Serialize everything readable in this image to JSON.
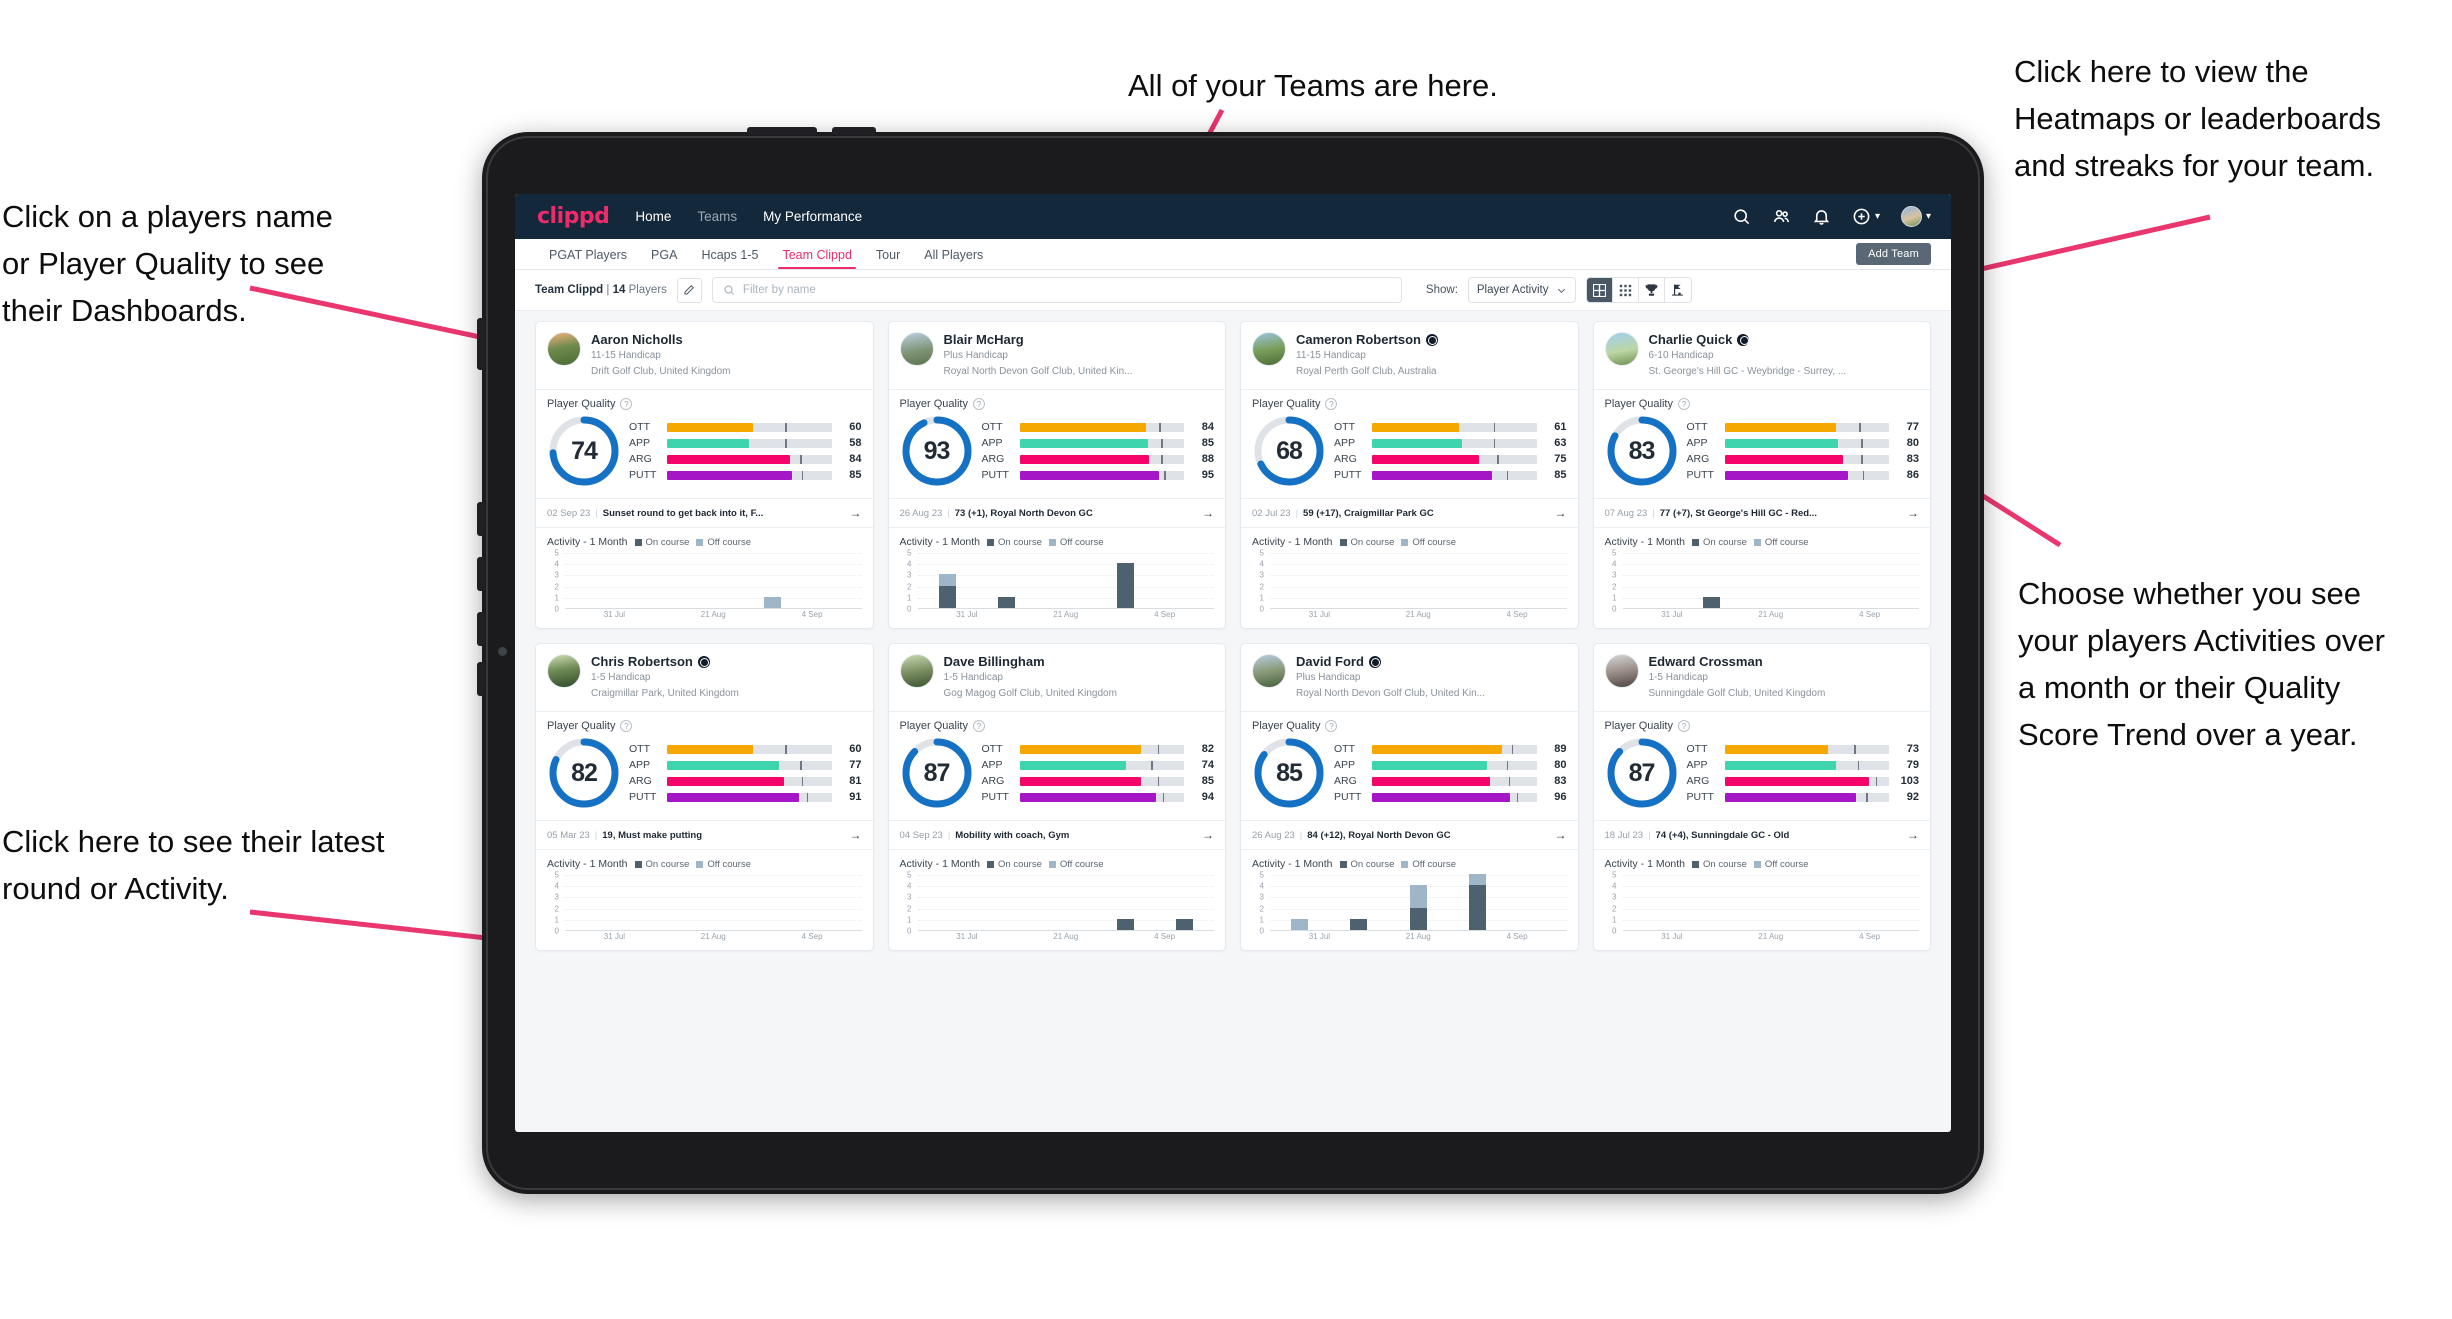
{
  "annotations": [
    {
      "id": "a-teams",
      "text": "All of your Teams are here."
    },
    {
      "id": "a-heatmap",
      "text": "Click here to view the\nHeatmaps or leaderboards\nand streaks for your team."
    },
    {
      "id": "a-name",
      "text": "Click on a players name\nor Player Quality to see\ntheir Dashboards."
    },
    {
      "id": "a-choose",
      "text": "Choose whether you see\nyour players Activities over\na month or their Quality\nScore Trend over a year."
    },
    {
      "id": "a-latest",
      "text": "Click here to see their latest\nround or Activity."
    }
  ],
  "app": {
    "brand": "clippd",
    "nav_links": [
      {
        "label": "Home",
        "active": true
      },
      {
        "label": "Teams",
        "active": false
      },
      {
        "label": "My Performance",
        "active": true
      }
    ],
    "nav_icons": [
      "search-icon",
      "people-icon",
      "bell-icon",
      "plus-circle-icon",
      "avatar"
    ],
    "tabs": [
      {
        "label": "PGAT Players",
        "active": false
      },
      {
        "label": "PGA",
        "active": false
      },
      {
        "label": "Hcaps 1-5",
        "active": false
      },
      {
        "label": "Team Clippd",
        "active": true
      },
      {
        "label": "Tour",
        "active": false
      },
      {
        "label": "All Players",
        "active": false
      }
    ],
    "add_team_label": "Add Team",
    "toolbar": {
      "team_name": "Team Clippd",
      "divider": "|",
      "player_count": "14",
      "players_word": "Players",
      "edit_icon": "pencil-icon",
      "search_placeholder": "Filter by name",
      "search_value": "",
      "show_label": "Show:",
      "show_value": "Player Activity",
      "show_options": [
        "Player Activity",
        "Quality Score Trend"
      ],
      "views": [
        {
          "name": "grid-large-view",
          "active": true
        },
        {
          "name": "grid-small-view",
          "active": false
        },
        {
          "name": "trophy-leaderboard-view",
          "active": false
        },
        {
          "name": "flag-course-view",
          "active": false
        }
      ]
    }
  },
  "card_labels": {
    "player_quality": "Player Quality",
    "activity": "Activity - 1 Month",
    "legend_on": "On course",
    "legend_off": "Off course",
    "metric_keys": [
      "OTT",
      "APP",
      "ARG",
      "PUTT"
    ]
  },
  "metric_colors": {
    "OTT": "#f5a800",
    "APP": "#3ed4ae",
    "ARG": "#f5056a",
    "PUTT": "#a516c6",
    "ring": "#1471c4",
    "track": "#dfe3e7"
  },
  "chart_data": {
    "type": "bar",
    "stacked": true,
    "ylim": [
      0,
      5
    ],
    "yticks": [
      0,
      1,
      2,
      3,
      4,
      5
    ],
    "xticks": [
      "31 Jul",
      "21 Aug",
      "4 Sep"
    ],
    "series_names": [
      "On course",
      "Off course"
    ],
    "series_colors": [
      "#4d616f",
      "#9fb6c8"
    ]
  },
  "players": [
    {
      "avatar_class": "av1",
      "name": "Aaron Nicholls",
      "verified": false,
      "handicap": "11-15 Handicap",
      "club": "Drift Golf Club, United Kingdom",
      "quality": 74,
      "metrics": [
        {
          "key": "OTT",
          "value": 60,
          "fill": 52,
          "tick": 72
        },
        {
          "key": "APP",
          "value": 58,
          "fill": 50,
          "tick": 72
        },
        {
          "key": "ARG",
          "value": 84,
          "fill": 75,
          "tick": 81
        },
        {
          "key": "PUTT",
          "value": 85,
          "fill": 76,
          "tick": 82
        }
      ],
      "latest_date": "02 Sep 23",
      "latest_text": "Sunset round to get back into it, F...",
      "activity": [
        {
          "on": 0,
          "off": 0
        },
        {
          "on": 0,
          "off": 0
        },
        {
          "on": 0,
          "off": 0
        },
        {
          "on": 0,
          "off": 1
        },
        {
          "on": 0,
          "off": 0
        }
      ]
    },
    {
      "avatar_class": "av2",
      "name": "Blair McHarg",
      "verified": false,
      "handicap": "Plus Handicap",
      "club": "Royal North Devon Golf Club, United Kin...",
      "quality": 93,
      "metrics": [
        {
          "key": "OTT",
          "value": 84,
          "fill": 77,
          "tick": 85
        },
        {
          "key": "APP",
          "value": 85,
          "fill": 78,
          "tick": 86
        },
        {
          "key": "ARG",
          "value": 88,
          "fill": 79,
          "tick": 86
        },
        {
          "key": "PUTT",
          "value": 95,
          "fill": 85,
          "tick": 88
        }
      ],
      "latest_date": "26 Aug 23",
      "latest_text": "73 (+1), Royal North Devon GC",
      "activity": [
        {
          "on": 2,
          "off": 1
        },
        {
          "on": 1,
          "off": 0
        },
        {
          "on": 0,
          "off": 0
        },
        {
          "on": 4,
          "off": 0
        },
        {
          "on": 0,
          "off": 0
        }
      ]
    },
    {
      "avatar_class": "av3",
      "name": "Cameron Robertson",
      "verified": true,
      "handicap": "11-15 Handicap",
      "club": "Royal Perth Golf Club, Australia",
      "quality": 68,
      "metrics": [
        {
          "key": "OTT",
          "value": 61,
          "fill": 53,
          "tick": 74
        },
        {
          "key": "APP",
          "value": 63,
          "fill": 55,
          "tick": 74
        },
        {
          "key": "ARG",
          "value": 75,
          "fill": 65,
          "tick": 76
        },
        {
          "key": "PUTT",
          "value": 85,
          "fill": 73,
          "tick": 82
        }
      ],
      "latest_date": "02 Jul 23",
      "latest_text": "59 (+17), Craigmillar Park GC",
      "activity": [
        {
          "on": 0,
          "off": 0
        },
        {
          "on": 0,
          "off": 0
        },
        {
          "on": 0,
          "off": 0
        },
        {
          "on": 0,
          "off": 0
        },
        {
          "on": 0,
          "off": 0
        }
      ]
    },
    {
      "avatar_class": "av4",
      "name": "Charlie Quick",
      "verified": true,
      "handicap": "6-10 Handicap",
      "club": "St. George's Hill GC - Weybridge - Surrey, ...",
      "quality": 83,
      "metrics": [
        {
          "key": "OTT",
          "value": 77,
          "fill": 68,
          "tick": 82
        },
        {
          "key": "APP",
          "value": 80,
          "fill": 69,
          "tick": 83
        },
        {
          "key": "ARG",
          "value": 83,
          "fill": 72,
          "tick": 83
        },
        {
          "key": "PUTT",
          "value": 86,
          "fill": 75,
          "tick": 84
        }
      ],
      "latest_date": "07 Aug 23",
      "latest_text": "77 (+7), St George's Hill GC - Red...",
      "activity": [
        {
          "on": 0,
          "off": 0
        },
        {
          "on": 1,
          "off": 0
        },
        {
          "on": 0,
          "off": 0
        },
        {
          "on": 0,
          "off": 0
        },
        {
          "on": 0,
          "off": 0
        }
      ]
    },
    {
      "avatar_class": "av5",
      "name": "Chris Robertson",
      "verified": true,
      "handicap": "1-5 Handicap",
      "club": "Craigmillar Park, United Kingdom",
      "quality": 82,
      "metrics": [
        {
          "key": "OTT",
          "value": 60,
          "fill": 52,
          "tick": 72
        },
        {
          "key": "APP",
          "value": 77,
          "fill": 68,
          "tick": 81
        },
        {
          "key": "ARG",
          "value": 81,
          "fill": 71,
          "tick": 82
        },
        {
          "key": "PUTT",
          "value": 91,
          "fill": 80,
          "tick": 85
        }
      ],
      "latest_date": "05 Mar 23",
      "latest_text": "19, Must make putting",
      "activity": [
        {
          "on": 0,
          "off": 0
        },
        {
          "on": 0,
          "off": 0
        },
        {
          "on": 0,
          "off": 0
        },
        {
          "on": 0,
          "off": 0
        },
        {
          "on": 0,
          "off": 0
        }
      ]
    },
    {
      "avatar_class": "av6",
      "name": "Dave Billingham",
      "verified": false,
      "handicap": "1-5 Handicap",
      "club": "Gog Magog Golf Club, United Kingdom",
      "quality": 87,
      "metrics": [
        {
          "key": "OTT",
          "value": 82,
          "fill": 74,
          "tick": 84
        },
        {
          "key": "APP",
          "value": 74,
          "fill": 65,
          "tick": 80
        },
        {
          "key": "ARG",
          "value": 85,
          "fill": 74,
          "tick": 84
        },
        {
          "key": "PUTT",
          "value": 94,
          "fill": 83,
          "tick": 87
        }
      ],
      "latest_date": "04 Sep 23",
      "latest_text": "Mobility with coach, Gym",
      "activity": [
        {
          "on": 0,
          "off": 0
        },
        {
          "on": 0,
          "off": 0
        },
        {
          "on": 0,
          "off": 0
        },
        {
          "on": 1,
          "off": 0
        },
        {
          "on": 1,
          "off": 0
        }
      ]
    },
    {
      "avatar_class": "av7",
      "name": "David Ford",
      "verified": true,
      "handicap": "Plus Handicap",
      "club": "Royal North Devon Golf Club, United Kin...",
      "quality": 85,
      "metrics": [
        {
          "key": "OTT",
          "value": 89,
          "fill": 79,
          "tick": 85
        },
        {
          "key": "APP",
          "value": 80,
          "fill": 70,
          "tick": 82
        },
        {
          "key": "ARG",
          "value": 83,
          "fill": 72,
          "tick": 83
        },
        {
          "key": "PUTT",
          "value": 96,
          "fill": 84,
          "tick": 88
        }
      ],
      "latest_date": "26 Aug 23",
      "latest_text": "84 (+12), Royal North Devon GC",
      "activity": [
        {
          "on": 0,
          "off": 1
        },
        {
          "on": 1,
          "off": 0
        },
        {
          "on": 2,
          "off": 2
        },
        {
          "on": 4,
          "off": 1
        },
        {
          "on": 0,
          "off": 0
        }
      ]
    },
    {
      "avatar_class": "av8",
      "name": "Edward Crossman",
      "verified": false,
      "handicap": "1-5 Handicap",
      "club": "Sunningdale Golf Club, United Kingdom",
      "quality": 87,
      "metrics": [
        {
          "key": "OTT",
          "value": 73,
          "fill": 63,
          "tick": 79
        },
        {
          "key": "APP",
          "value": 79,
          "fill": 68,
          "tick": 81
        },
        {
          "key": "ARG",
          "value": 103,
          "fill": 88,
          "tick": 92
        },
        {
          "key": "PUTT",
          "value": 92,
          "fill": 80,
          "tick": 86
        }
      ],
      "latest_date": "18 Jul 23",
      "latest_text": "74 (+4), Sunningdale GC - Old",
      "activity": [
        {
          "on": 0,
          "off": 0
        },
        {
          "on": 0,
          "off": 0
        },
        {
          "on": 0,
          "off": 0
        },
        {
          "on": 0,
          "off": 0
        },
        {
          "on": 0,
          "off": 0
        }
      ]
    }
  ]
}
